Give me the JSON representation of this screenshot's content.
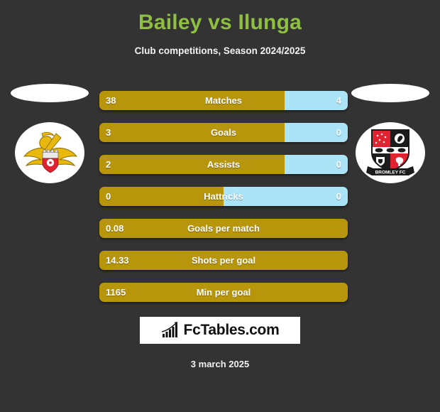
{
  "header": {
    "title": "Bailey vs Ilunga",
    "subtitle": "Club competitions, Season 2024/2025",
    "title_color": "#8fbf40"
  },
  "colors": {
    "background": "#333333",
    "home_bar": "#b8960c",
    "away_bar": "#abe3f7",
    "text": "#ffffff"
  },
  "teams": {
    "home": {
      "badge_name": "doncaster-rovers-badge",
      "photo_name": "bailey-player-photo"
    },
    "away": {
      "badge_name": "bromley-fc-badge",
      "photo_name": "ilunga-player-photo",
      "badge_banner_text": "BROMLEY FC"
    }
  },
  "stats": [
    {
      "label": "Matches",
      "home": "38",
      "away": "4",
      "home_pct": 74.6,
      "split": true
    },
    {
      "label": "Goals",
      "home": "3",
      "away": "0",
      "home_pct": 74.6,
      "split": true
    },
    {
      "label": "Assists",
      "home": "2",
      "away": "0",
      "home_pct": 74.6,
      "split": true
    },
    {
      "label": "Hattricks",
      "home": "0",
      "away": "0",
      "home_pct": 50.0,
      "split": true
    },
    {
      "label": "Goals per match",
      "home": "0.08",
      "away": "",
      "home_pct": 100,
      "split": false
    },
    {
      "label": "Shots per goal",
      "home": "14.33",
      "away": "",
      "home_pct": 100,
      "split": false
    },
    {
      "label": "Min per goal",
      "home": "1165",
      "away": "",
      "home_pct": 100,
      "split": false
    }
  ],
  "footer": {
    "logo_text": "FcTables.com",
    "logo_icon": "bar-chart-growth-icon",
    "date": "3 march 2025"
  }
}
